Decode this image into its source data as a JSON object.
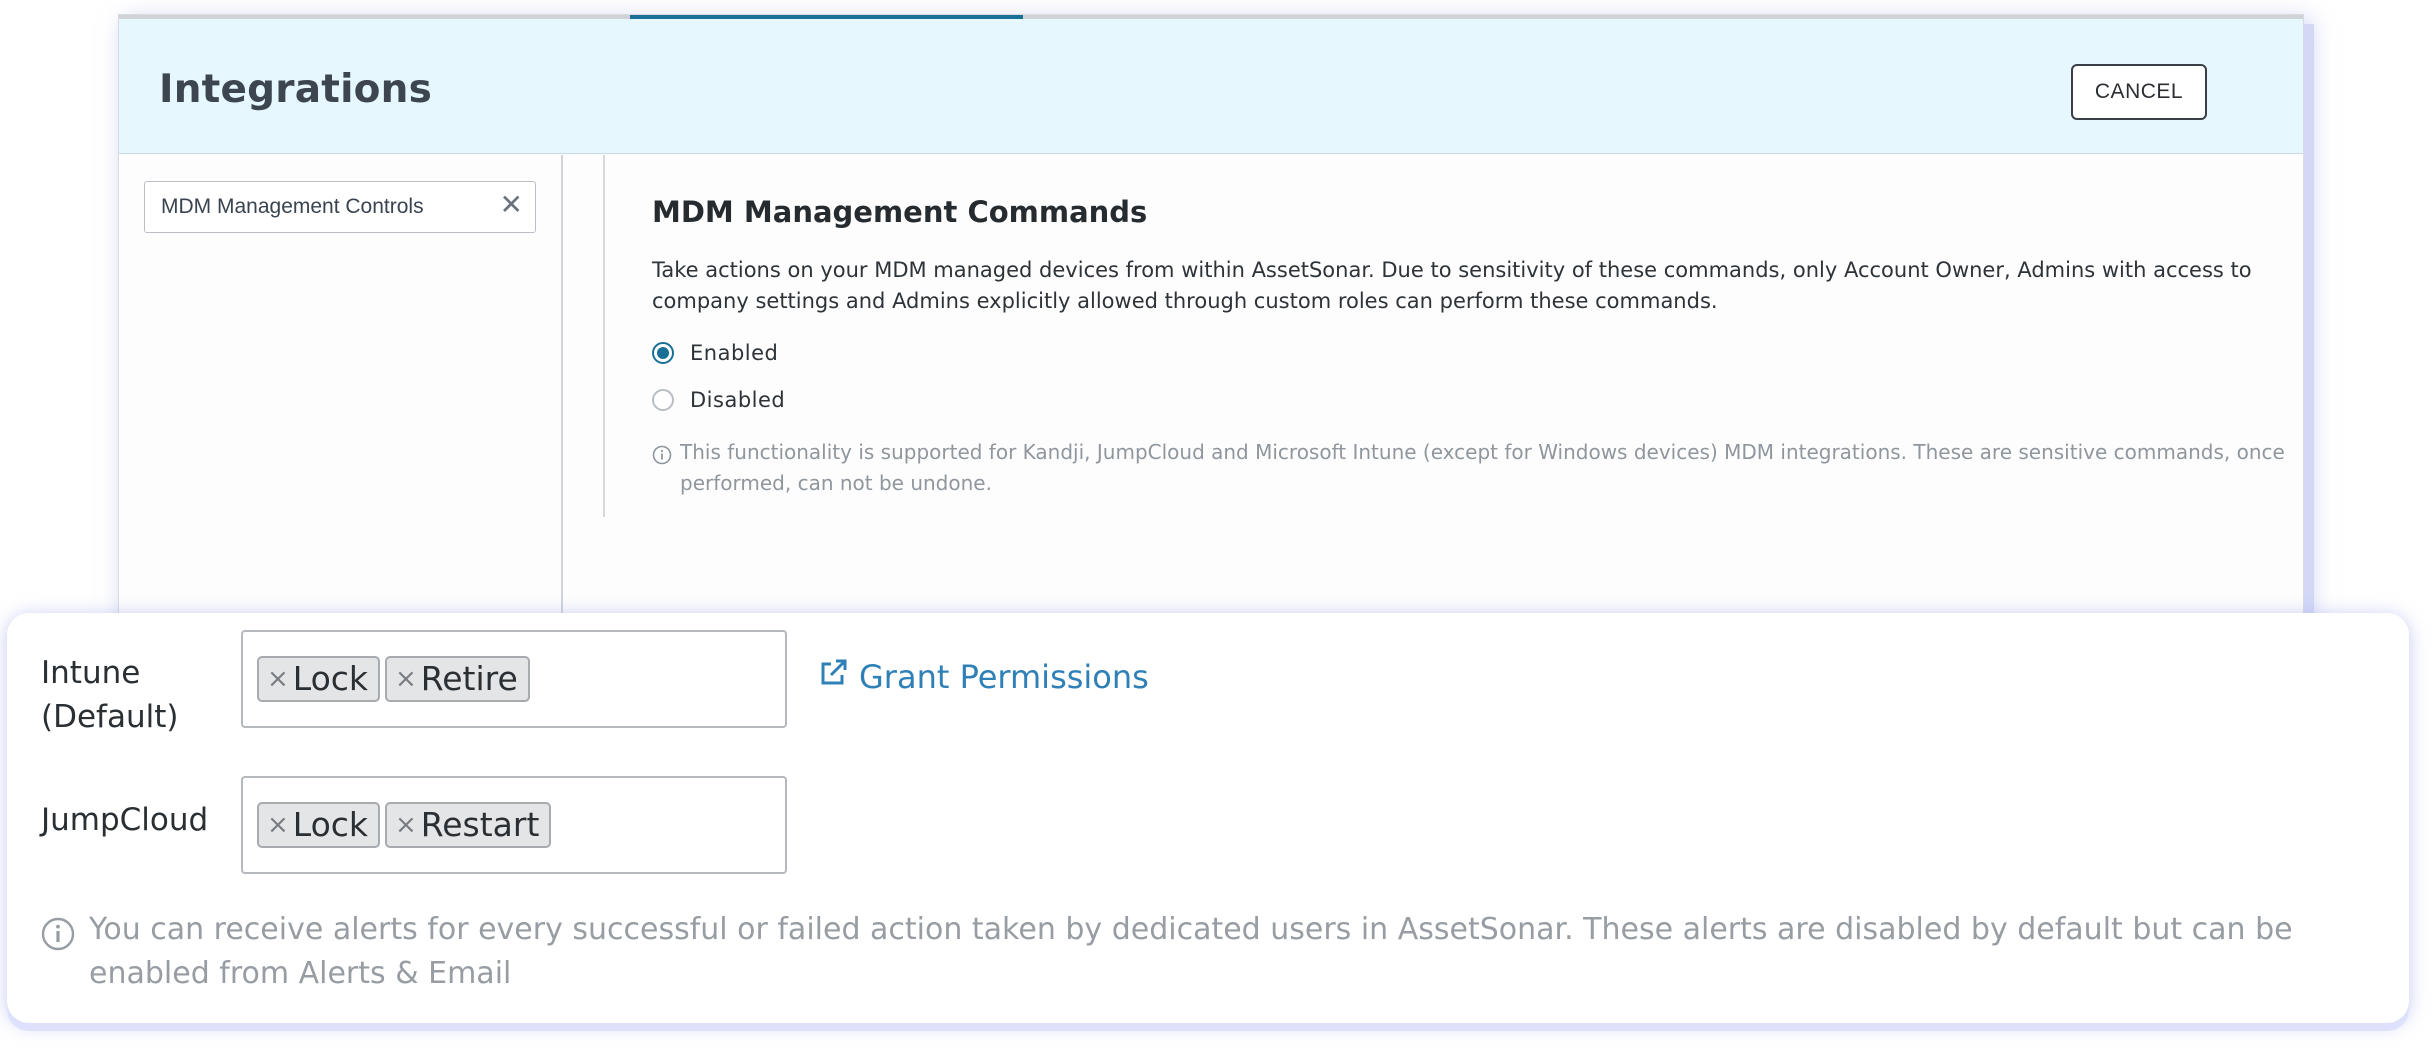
{
  "header": {
    "title": "Integrations",
    "cancel_label": "CANCEL",
    "progress_fraction": 0.18
  },
  "sidebar": {
    "filter_value": "MDM Management Controls",
    "clear_icon": "close-icon"
  },
  "section": {
    "title": "MDM Management Commands",
    "description": "Take actions on your MDM managed devices from within AssetSonar. Due to sensitivity of these commands, only Account Owner, Admins with access to company settings and Admins explicitly allowed through custom roles can perform these commands.",
    "options": [
      {
        "label": "Enabled",
        "checked": true
      },
      {
        "label": "Disabled",
        "checked": false
      }
    ],
    "note": "This functionality is supported for Kandji, JumpCloud and Microsoft Intune (except for Windows devices) MDM integrations. These are sensitive commands, once performed, can not be undone."
  },
  "permissions": {
    "rows": [
      {
        "label": "Intune (Default)",
        "tags": [
          "Lock",
          "Retire"
        ]
      },
      {
        "label": "JumpCloud",
        "tags": [
          "Lock",
          "Restart"
        ]
      }
    ],
    "grant_link": "Grant Permissions",
    "remove_glyph": "×",
    "note": "You can receive alerts for every successful or failed action taken by dedicated users in AssetSonar. These alerts are disabled by default but can be enabled from Alerts & Email"
  },
  "colors": {
    "accent": "#1a6f96",
    "link": "#2f80b6",
    "header_bg": "#e6f7fd",
    "muted_text": "#8f969d"
  }
}
